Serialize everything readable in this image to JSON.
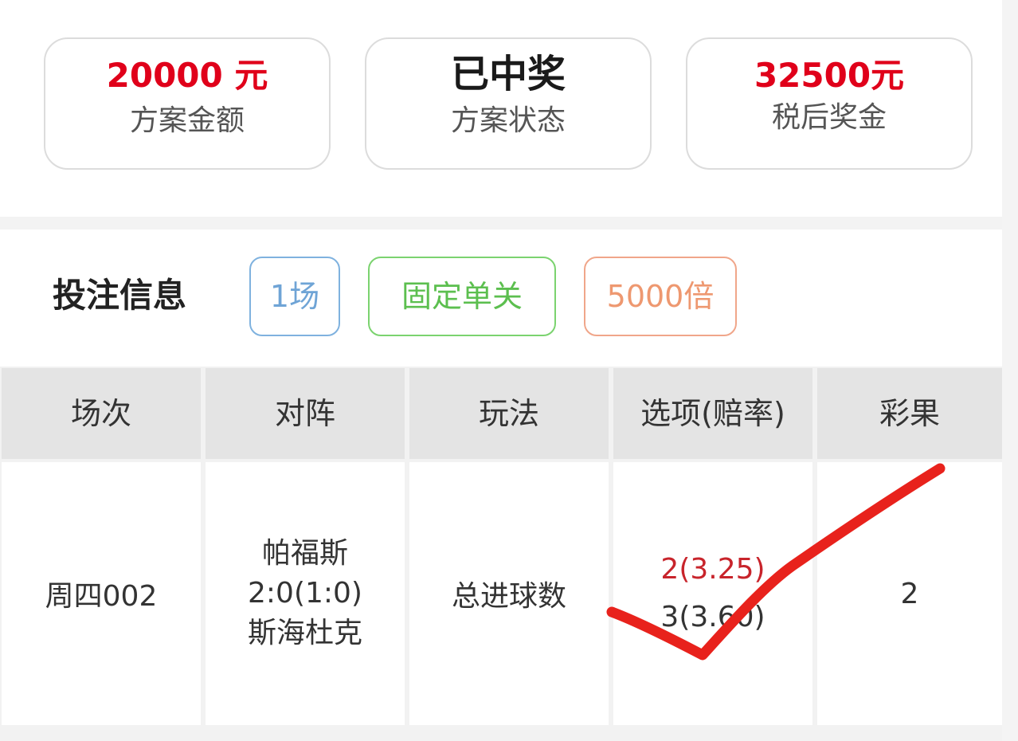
{
  "summary": {
    "amount_value": "20000 元",
    "amount_label": "方案金额",
    "status_value": "已中奖",
    "status_label": "方案状态",
    "prize_value": "32500元",
    "prize_label": "税后奖金"
  },
  "bet_info": {
    "title": "投注信息",
    "tags": [
      "1场",
      "固定单关",
      "5000倍"
    ]
  },
  "table": {
    "headers": [
      "场次",
      "对阵",
      "玩法",
      "选项(赔率)",
      "彩果"
    ],
    "row": {
      "match_no": "周四002",
      "home_team": "帕福斯",
      "score": "2:0(1:0)",
      "away_team": "斯海杜克",
      "play_type": "总进球数",
      "option_hit": "2(3.25)",
      "option_other": "3(3.60)",
      "result": "2"
    }
  },
  "colors": {
    "accent_red": "#e0001a",
    "tag_blue": "#6fa4d6",
    "tag_green": "#5cbf4f",
    "tag_orange": "#ee9870",
    "check_red": "#e8221c"
  },
  "icons": {
    "checkmark": "checkmark-icon"
  }
}
